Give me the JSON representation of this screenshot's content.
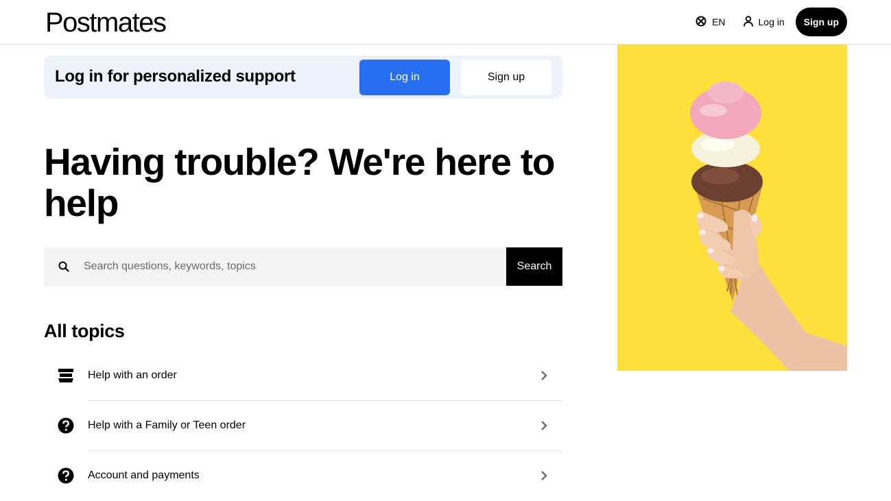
{
  "header": {
    "logo": "Postmates",
    "language": "EN",
    "login": "Log in",
    "signup": "Sign up"
  },
  "banner": {
    "title": "Log in for personalized support",
    "login": "Log in",
    "signup": "Sign up"
  },
  "hero": {
    "line1": "Having trouble? We're here to",
    "line2": "help"
  },
  "search": {
    "placeholder": "Search questions, keywords, topics",
    "button": "Search"
  },
  "topics": {
    "title": "All topics",
    "items": [
      {
        "label": "Help with an order",
        "icon": "store-icon"
      },
      {
        "label": "Help with a Family or Teen order",
        "icon": "question-circle-icon"
      },
      {
        "label": "Account and payments",
        "icon": "question-circle-icon"
      }
    ]
  },
  "colors": {
    "brand_blue": "#276ef1",
    "banner_bg": "#eef2fb",
    "promo_bg": "#fde03b",
    "search_bg": "#f3f3f3"
  }
}
